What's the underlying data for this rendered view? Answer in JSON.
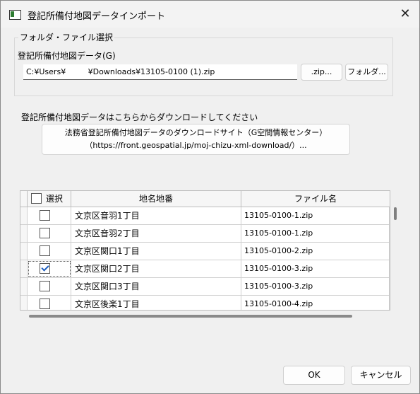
{
  "window": {
    "title": "登記所備付地図データインポート",
    "close_glyph": "✕"
  },
  "group": {
    "title": "フォルダ・ファイル選択"
  },
  "file": {
    "label": "登記所備付地図データ(G)",
    "path_value": "C:¥Users¥         ¥Downloads¥13105-0100 (1).zip",
    "zip_button": ".zip...",
    "folder_button": "フォルダ..."
  },
  "download": {
    "label": "登記所備付地図データはこちらからダウンロードしてください",
    "link_line1": "法務省登記所備付地図データのダウンロードサイト（G空間情報センター）",
    "link_line2": "（https://front.geospatial.jp/moj-chizu-xml-download/）..."
  },
  "table": {
    "columns": [
      "選択",
      "地名地番",
      "ファイル名"
    ],
    "rows": [
      {
        "checked": false,
        "name": "文京区音羽1丁目",
        "file": "13105-0100-1.zip"
      },
      {
        "checked": false,
        "name": "文京区音羽2丁目",
        "file": "13105-0100-1.zip"
      },
      {
        "checked": false,
        "name": "文京区関口1丁目",
        "file": "13105-0100-2.zip"
      },
      {
        "checked": true,
        "name": "文京区関口2丁目",
        "file": "13105-0100-3.zip"
      },
      {
        "checked": false,
        "name": "文京区関口3丁目",
        "file": "13105-0100-3.zip"
      },
      {
        "checked": false,
        "name": "文京区後楽1丁目",
        "file": "13105-0100-4.zip"
      }
    ]
  },
  "footer": {
    "ok": "OK",
    "cancel": "キャンセル"
  }
}
